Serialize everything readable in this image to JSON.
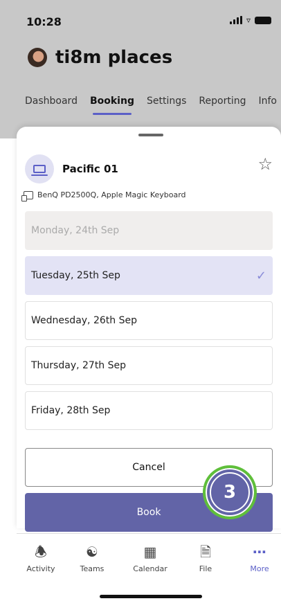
{
  "status_bar": {
    "time": "10:28"
  },
  "app": {
    "title": "ti8m places"
  },
  "tabs": [
    {
      "label": "Dashboard"
    },
    {
      "label": "Booking"
    },
    {
      "label": "Settings"
    },
    {
      "label": "Reporting"
    },
    {
      "label": "Info"
    }
  ],
  "resource": {
    "name": "Pacific 01",
    "equipment": "BenQ PD2500Q, Apple Magic Keyboard"
  },
  "days": [
    {
      "label": "Monday, 24th Sep"
    },
    {
      "label": "Tuesday, 25th Sep"
    },
    {
      "label": "Wednesday, 26th Sep"
    },
    {
      "label": "Thursday, 27th Sep"
    },
    {
      "label": "Friday, 28th Sep"
    }
  ],
  "actions": {
    "cancel_label": "Cancel",
    "book_label": "Book"
  },
  "step_badge": "3",
  "bottom_nav": [
    {
      "label": "Activity",
      "icon": "bell-icon"
    },
    {
      "label": "Teams",
      "icon": "teams-icon"
    },
    {
      "label": "Calendar",
      "icon": "calendar-icon"
    },
    {
      "label": "File",
      "icon": "file-icon"
    },
    {
      "label": "More",
      "icon": "more-icon"
    }
  ],
  "colors": {
    "accent": "#6264a7",
    "selected_day": "#e3e3f5",
    "disabled_day": "#f0eeed",
    "step_ring": "#5fbf3a"
  }
}
